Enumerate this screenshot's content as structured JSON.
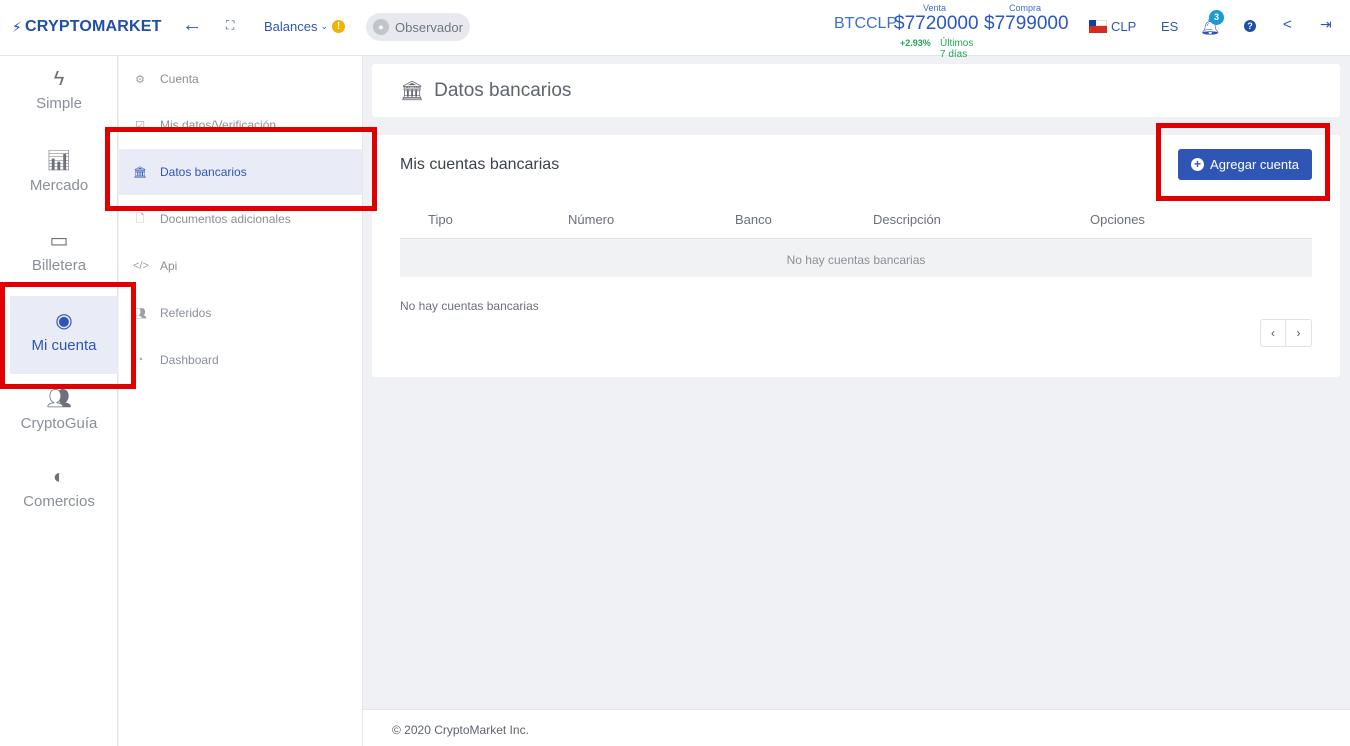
{
  "app": {
    "logo": "CRYPTOMARKET",
    "balances_label": "Balances",
    "warning_badge": "!",
    "observer_label": "Observador"
  },
  "ticker": {
    "pair": "BTCCLP",
    "venta_label": "Venta",
    "venta_value": "$7720000",
    "compra_label": "Compra",
    "compra_value": "$7799000",
    "change": "+2.93%",
    "period": "Últimos 7 días"
  },
  "header_right": {
    "currency": "CLP",
    "language": "ES",
    "notification_count": "3",
    "help": "?"
  },
  "rail": {
    "items": [
      {
        "label": "Simple",
        "icon": "bolt-icon"
      },
      {
        "label": "Mercado",
        "icon": "bar-chart-icon"
      },
      {
        "label": "Billetera",
        "icon": "wallet-icon"
      },
      {
        "label": "Mi cuenta",
        "icon": "user-circle-icon"
      },
      {
        "label": "CryptoGuía",
        "icon": "users-icon"
      },
      {
        "label": "Comercios",
        "icon": "store-icon"
      }
    ]
  },
  "submenu": {
    "items": [
      {
        "label": "Cuenta",
        "icon": "gear-icon"
      },
      {
        "label": "Mis datos/Verificación",
        "icon": "check-square-icon"
      },
      {
        "label": "Datos bancarios",
        "icon": "bank-icon"
      },
      {
        "label": "Documentos adicionales",
        "icon": "file-icon"
      },
      {
        "label": "Api",
        "icon": "code-icon"
      },
      {
        "label": "Referidos",
        "icon": "users-icon"
      },
      {
        "label": "Dashboard",
        "icon": "dashboard-icon"
      }
    ]
  },
  "main": {
    "page_title": "Datos bancarios",
    "card_title": "Mis cuentas bancarias",
    "add_button": "Agregar cuenta",
    "columns": [
      "Tipo",
      "Número",
      "Banco",
      "Descripción",
      "Opciones"
    ],
    "empty_row": "No hay cuentas bancarias",
    "empty_text": "No hay cuentas bancarias",
    "pager_prev": "‹",
    "pager_next": "›"
  },
  "footer": {
    "text": "© 2020 CryptoMarket Inc."
  },
  "colors": {
    "brand": "#2f55b5",
    "highlight": "#e00000",
    "positive": "#23a455"
  }
}
